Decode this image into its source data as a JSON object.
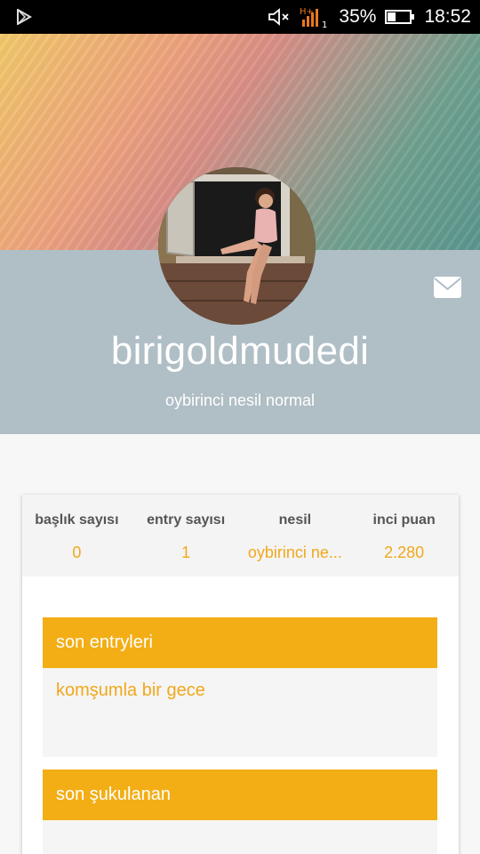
{
  "status_bar": {
    "time": "18:52",
    "battery_percent": "35%",
    "network_label": "H+",
    "sim_label": "1",
    "icons": [
      "play-store-icon",
      "mute-icon",
      "signal-icon",
      "battery-icon"
    ]
  },
  "profile": {
    "username": "birigoldmudedi",
    "subtitle": "oybirinci nesil normal",
    "message_icon": "mail-icon"
  },
  "stats": [
    {
      "label": "başlık sayısı",
      "value": "0"
    },
    {
      "label": "entry sayısı",
      "value": "1"
    },
    {
      "label": "nesil",
      "value": "oybirinci ne..."
    },
    {
      "label": "inci puan",
      "value": "2.280"
    }
  ],
  "sections": {
    "recent_entries": {
      "title": "son entryleri",
      "items": [
        "komşumla bir gece"
      ]
    },
    "recent_upvoted": {
      "title": "son şukulanan"
    }
  },
  "colors": {
    "accent": "#f3ae16",
    "header_bg": "#b0bec5",
    "link": "#f0a81c"
  }
}
